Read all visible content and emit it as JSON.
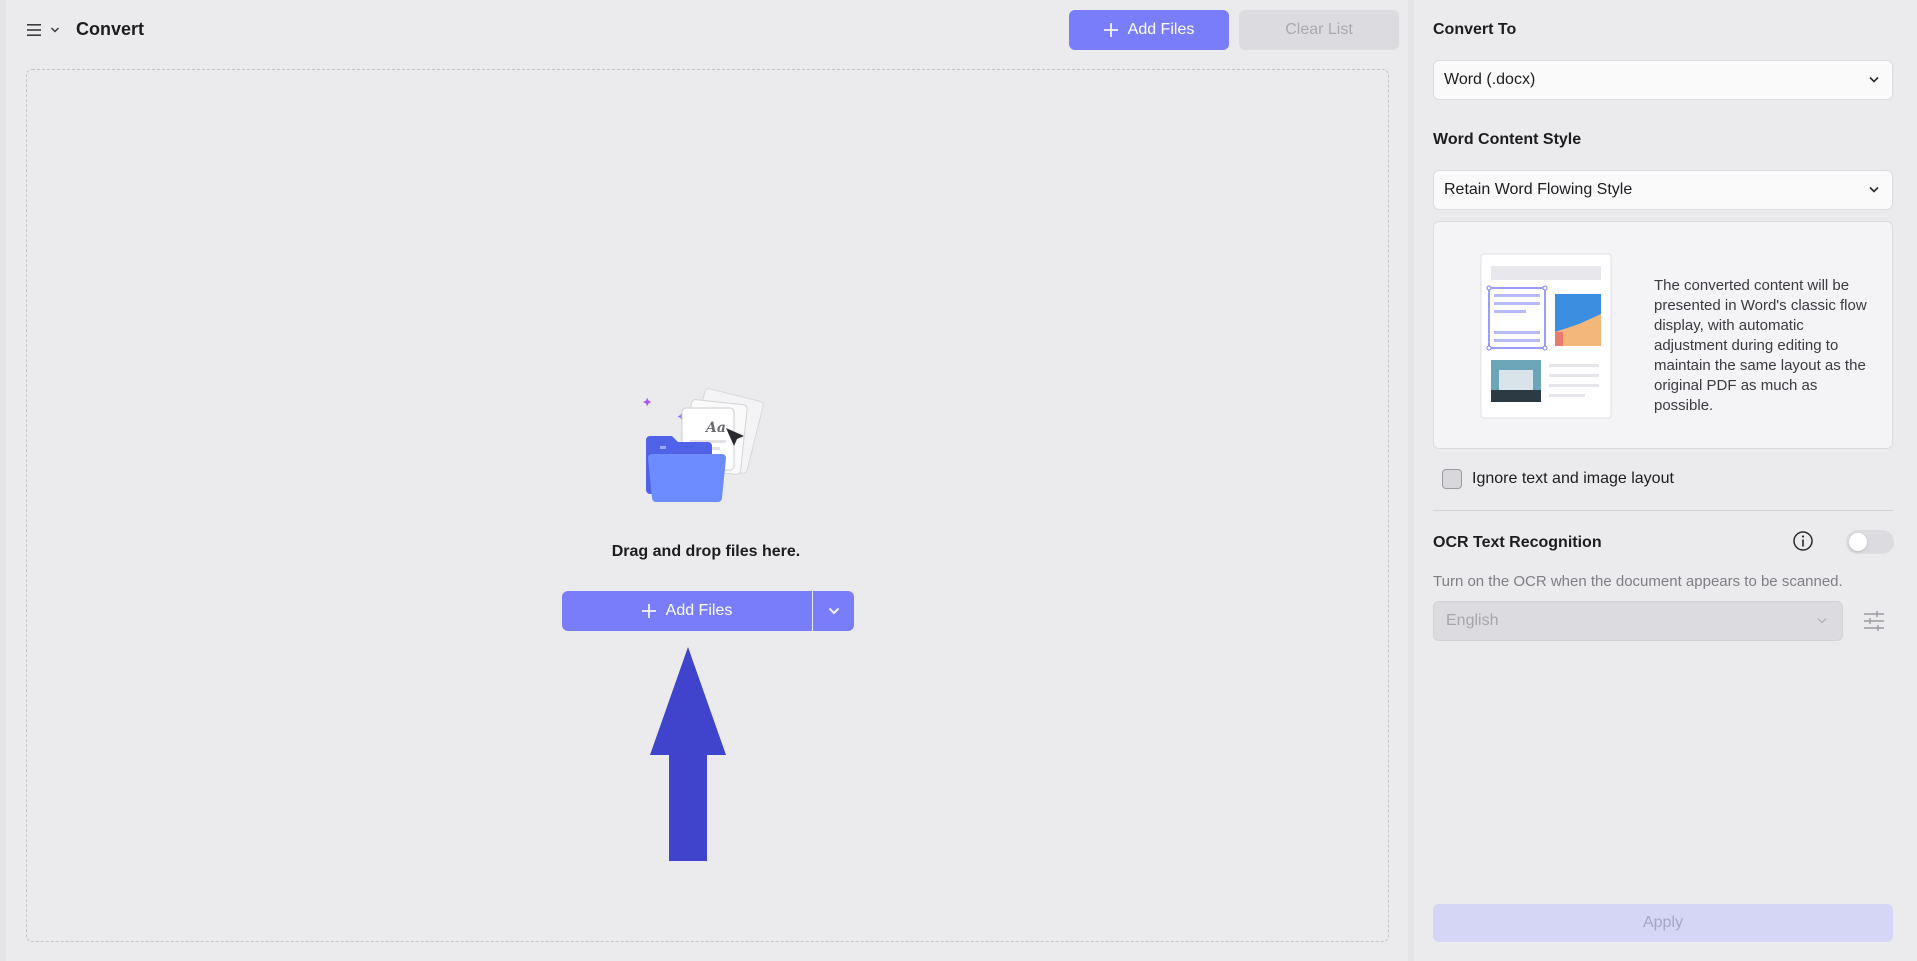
{
  "header": {
    "title": "Convert",
    "menu_icon": "hamburger-menu-icon",
    "add_files_label": "Add Files",
    "clear_list_label": "Clear List"
  },
  "drop_zone": {
    "prompt": "Drag and drop files here.",
    "add_files_label": "Add Files",
    "illustration": "folder-with-documents-illustration"
  },
  "settings": {
    "convert_to": {
      "label": "Convert To",
      "value": "Word (.docx)"
    },
    "content_style": {
      "label": "Word Content Style",
      "value": "Retain Word Flowing Style",
      "description": "The converted content will be presented in Word's classic flow display, with automatic adjustment during editing to maintain the same layout as the original PDF as much as possible."
    },
    "ignore_layout": {
      "label": "Ignore text and image layout",
      "checked": false
    },
    "ocr": {
      "label": "OCR Text Recognition",
      "enabled": false,
      "hint": "Turn on the OCR when the document appears to be scanned.",
      "language": "English"
    },
    "apply_label": "Apply"
  },
  "colors": {
    "accent": "#7a7df9",
    "arrow": "#4044cc",
    "apply_disabled": "#d5d5f6"
  }
}
